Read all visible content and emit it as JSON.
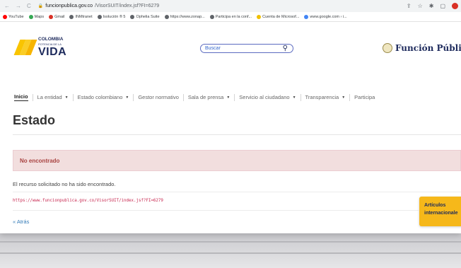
{
  "browser": {
    "url_domain": "funcionpublica.gov.co",
    "url_path": "/VisorSUIT/index.jsf?FI=6279"
  },
  "bookmarks": [
    {
      "label": "YouTube",
      "color": "#ff0000"
    },
    {
      "label": "Maps",
      "color": "#34a853"
    },
    {
      "label": "Gmail",
      "color": "#d93025"
    },
    {
      "label": "INMtranet",
      "color": "#5f6368"
    },
    {
      "label": "Isolución ® 5",
      "color": "#5f6368"
    },
    {
      "label": "Ophelia Suite",
      "color": "#5f6368"
    },
    {
      "label": "https://www.zonap...",
      "color": "#5f6368"
    },
    {
      "label": "Participa en la conf...",
      "color": "#5f6368"
    },
    {
      "label": "Cuenta de Microsof...",
      "color": "#f0c000"
    },
    {
      "label": "www.google.com › i...",
      "color": "#4285f4"
    }
  ],
  "logo": {
    "line1": "COLOMBIA",
    "line2": "POTENCIA DE LA",
    "line3": "VIDA"
  },
  "search": {
    "placeholder": "Buscar"
  },
  "entity_name": "Función Públic",
  "nav": [
    {
      "label": "Inicio",
      "dropdown": false,
      "active": true
    },
    {
      "label": "La entidad",
      "dropdown": true
    },
    {
      "label": "Estado colombiano",
      "dropdown": true
    },
    {
      "label": "Gestor normativo",
      "dropdown": false
    },
    {
      "label": "Sala de prensa",
      "dropdown": true
    },
    {
      "label": "Servicio al ciudadano",
      "dropdown": true
    },
    {
      "label": "Transparencia",
      "dropdown": true
    },
    {
      "label": "Participa",
      "dropdown": false
    }
  ],
  "page_title": "Estado",
  "alert_title": "No encontrado",
  "message": "El recurso solicitado no ha sido encontrado.",
  "requested_url": "https://www.funcionpublica.gov.co/VisorSUIT/index.jsf?FI=6279",
  "back_link": "« Atrás",
  "floating_button": {
    "line1": "Artículos",
    "line2": "internacionale"
  },
  "colors": {
    "brand_navy": "#1d2a5c",
    "brand_yellow": "#f9c400",
    "alert_bg": "#f2dede",
    "alert_text": "#a94442",
    "link": "#337ab7"
  }
}
